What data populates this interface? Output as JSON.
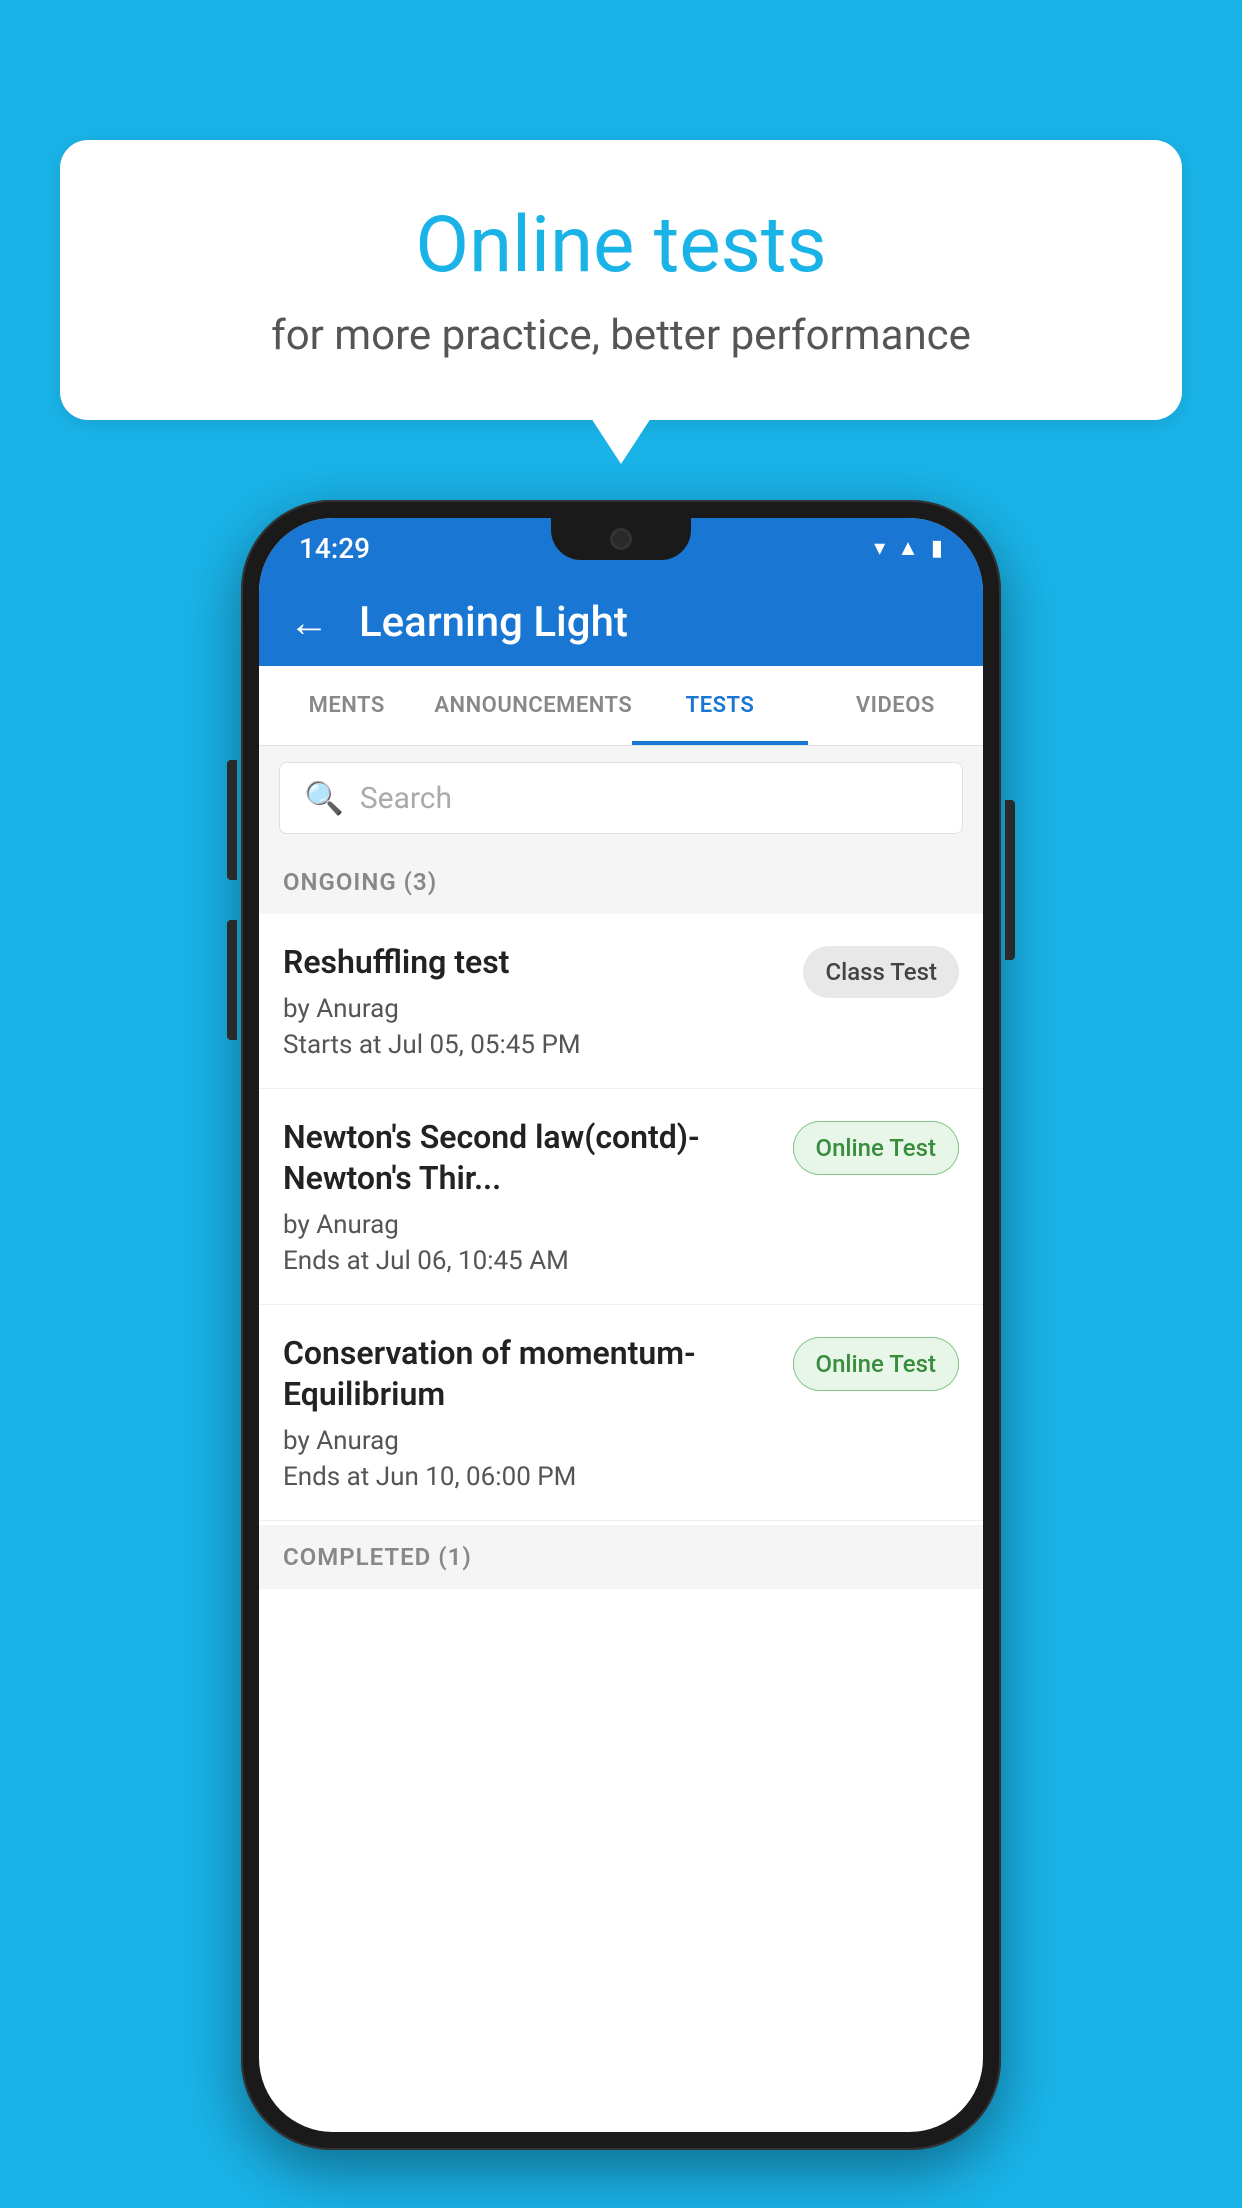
{
  "background": {
    "color": "#1ab3e8"
  },
  "speech_bubble": {
    "title": "Online tests",
    "subtitle": "for more practice, better performance"
  },
  "phone": {
    "status_bar": {
      "time": "14:29",
      "icons": [
        "wifi",
        "signal",
        "battery"
      ]
    },
    "app_header": {
      "back_label": "←",
      "title": "Learning Light"
    },
    "tabs": [
      {
        "label": "MENTS",
        "active": false
      },
      {
        "label": "ANNOUNCEMENTS",
        "active": false
      },
      {
        "label": "TESTS",
        "active": true
      },
      {
        "label": "VIDEOS",
        "active": false
      }
    ],
    "search": {
      "placeholder": "Search"
    },
    "ongoing_section": {
      "label": "ONGOING (3)"
    },
    "tests": [
      {
        "name": "Reshuffling test",
        "author": "by Anurag",
        "time_label": "Starts at",
        "time": "Jul 05, 05:45 PM",
        "badge": "Class Test",
        "badge_type": "class"
      },
      {
        "name": "Newton's Second law(contd)-Newton's Thir...",
        "author": "by Anurag",
        "time_label": "Ends at",
        "time": "Jul 06, 10:45 AM",
        "badge": "Online Test",
        "badge_type": "online"
      },
      {
        "name": "Conservation of momentum-Equilibrium",
        "author": "by Anurag",
        "time_label": "Ends at",
        "time": "Jun 10, 06:00 PM",
        "badge": "Online Test",
        "badge_type": "online"
      }
    ],
    "completed_section": {
      "label": "COMPLETED (1)"
    }
  }
}
